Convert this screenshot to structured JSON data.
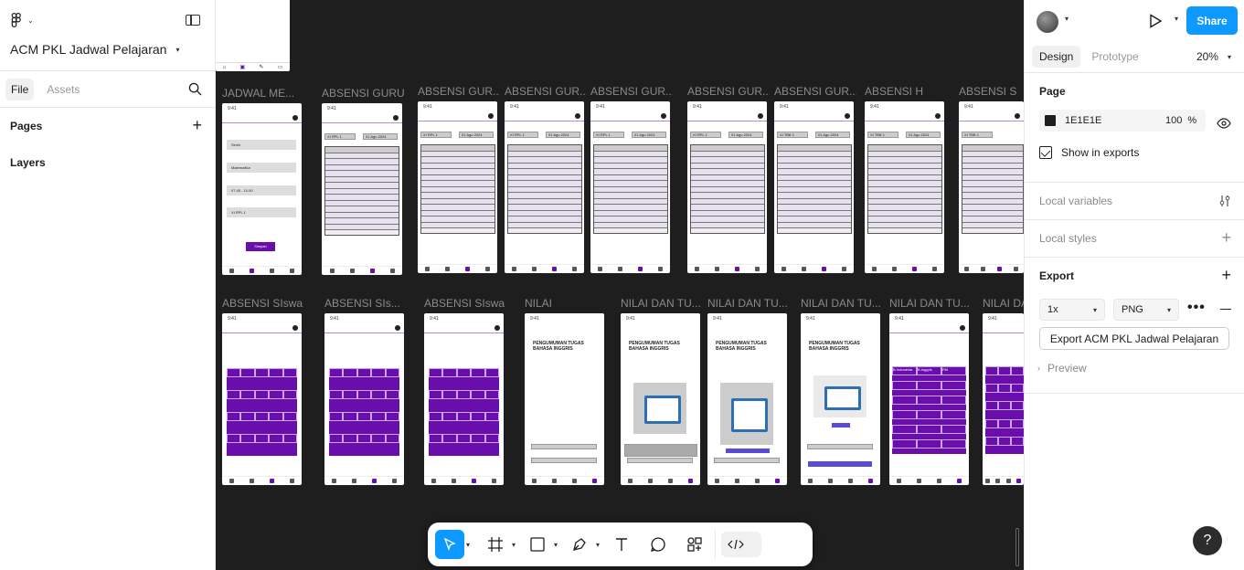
{
  "left": {
    "project_name": "ACM PKL Jadwal Pelajaran",
    "tabs": [
      "File",
      "Assets"
    ],
    "pages_label": "Pages",
    "layers_label": "Layers"
  },
  "canvas": {
    "row1_labels": [
      "JADWAL ME...",
      "ABSENSI GURU",
      "ABSENSI GUR...",
      "ABSENSI GUR...",
      "ABSENSI GUR...",
      "ABSENSI GUR...",
      "ABSENSI GUR...",
      "ABSENSI H",
      "ABSENSI S"
    ],
    "row2_labels": [
      "ABSENSI SIswa",
      "ABSENSI SIs...",
      "ABSENSI SIswa",
      "NILAI",
      "NILAI DAN TU...",
      "NILAI DAN TU...",
      "NILAI DAN TU...",
      "NILAI DAN TU...",
      "NILAI DA"
    ],
    "jadwal_fields": [
      "Senin",
      "Matematika",
      "07.45 - 10.00",
      "XI RPL 1"
    ],
    "jadwal_button": "Simpan",
    "absensi_class": "XI RPL 1",
    "absensi_date": "01 Agu 2024",
    "absensi_class_alt": "XI TBB 1",
    "pengumuman_title": "PENGUMUMAN TUGAS BAHASA INGGRIS",
    "nilai_headers": [
      "B.Indonesia",
      "B.Inggris",
      "PAI"
    ]
  },
  "toolbar": {
    "tools": [
      "move-tool",
      "frame-tool",
      "shape-tool",
      "pen-tool",
      "text-tool",
      "comment-tool",
      "actions-tool",
      "dev-mode-toggle"
    ]
  },
  "right": {
    "share_label": "Share",
    "tabs": [
      "Design",
      "Prototype"
    ],
    "zoom": "20%",
    "page_section": "Page",
    "page_color": "1E1E1E",
    "page_opacity": "100",
    "opacity_unit": "%",
    "show_in_exports": "Show in exports",
    "local_variables": "Local variables",
    "local_styles": "Local styles",
    "export_section": "Export",
    "export_scale": "1x",
    "export_format": "PNG",
    "export_button": "Export ACM PKL Jadwal Pelajaran",
    "preview": "Preview",
    "help": "?"
  },
  "colors": {
    "accent": "#0d99ff",
    "canvas_bg": "#1e1e1e",
    "frame_purple": "#6a0dad"
  }
}
